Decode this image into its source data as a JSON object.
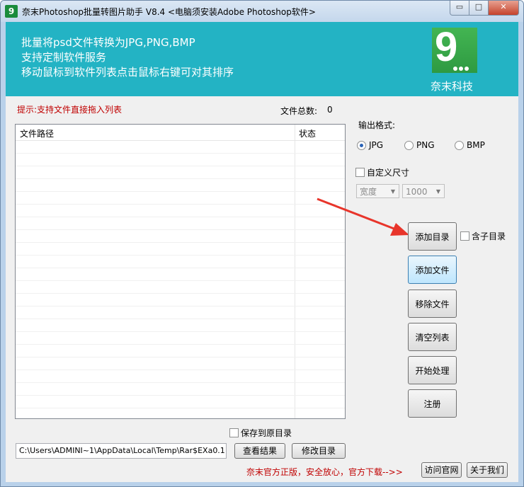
{
  "window": {
    "title": "奈末Photoshop批量转图片助手 V8.4 <电脑须安装Adobe Photoshop软件>",
    "min_glyph": "▭",
    "max_glyph": "□",
    "close_glyph": "✕",
    "app_icon_text": "9"
  },
  "banner": {
    "lines": [
      "批量将psd文件转换为JPG,PNG,BMP",
      "支持定制软件服务",
      "移动鼠标到软件列表点击鼠标右键可对其排序"
    ],
    "logo_text": "9",
    "brand": "奈末科技"
  },
  "tip": "提示:支持文件直接拖入列表",
  "file_total": {
    "label": "文件总数:",
    "value": "0"
  },
  "list": {
    "columns": [
      "文件路径",
      "状态"
    ]
  },
  "format": {
    "label": "输出格式:",
    "options": [
      "JPG",
      "PNG",
      "BMP"
    ],
    "selected": "JPG"
  },
  "custom_size": {
    "label": "自定义尺寸",
    "dimension": "宽度",
    "value": "1000"
  },
  "buttons": {
    "add_dir": "添加目录",
    "sub_dir": "含子目录",
    "add_file": "添加文件",
    "remove_file": "移除文件",
    "clear_list": "清空列表",
    "start": "开始处理",
    "register": "注册"
  },
  "output": {
    "save_to_original": "保存到原目录",
    "path": "C:\\Users\\ADMINI~1\\AppData\\Local\\Temp\\Rar$EXa0.1",
    "view_result": "查看结果",
    "change_dir": "修改目录"
  },
  "footer": {
    "promo": "奈末官方正版，安全放心，官方下载-->>",
    "visit_site": "访问官网",
    "about": "关于我们"
  },
  "colors": {
    "banner": "#23b3c4",
    "tip": "#c00000",
    "arrow": "#e8352b",
    "logo": "#34a853"
  }
}
